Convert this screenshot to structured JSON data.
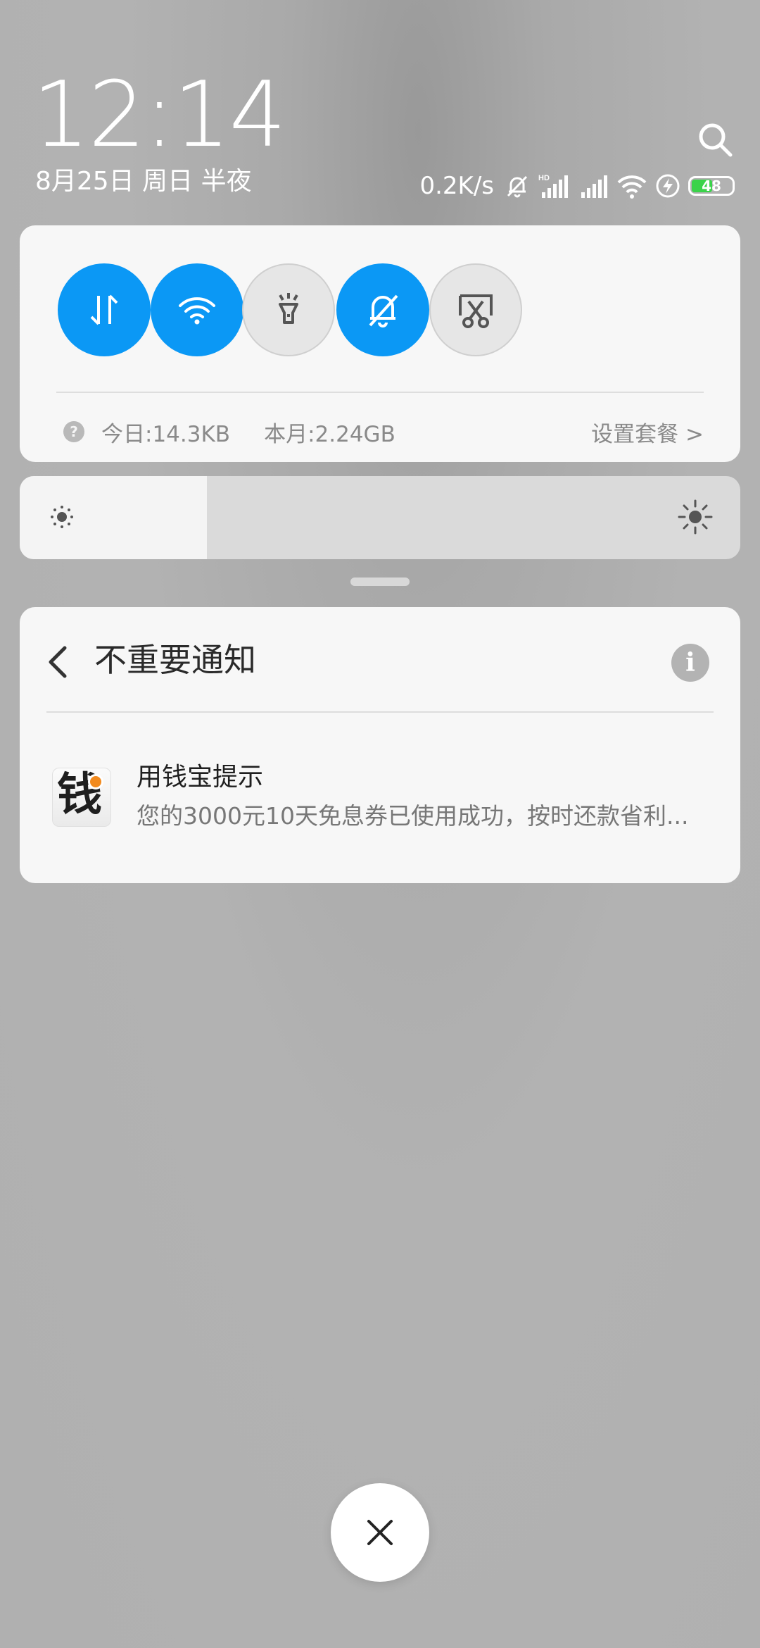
{
  "header": {
    "time": "12:14",
    "date": "8月25日 周日 半夜",
    "net_speed": "0.2K/s",
    "battery_level": "48"
  },
  "status_icons": [
    "mute-bell-icon",
    "hd-signal-icon",
    "signal-icon",
    "wifi-icon",
    "charging-icon",
    "battery-icon"
  ],
  "quick_settings": {
    "toggles": [
      {
        "name": "mobile-data",
        "icon": "data-arrows-icon",
        "state": "on"
      },
      {
        "name": "wifi",
        "icon": "wifi-icon",
        "state": "on"
      },
      {
        "name": "flashlight",
        "icon": "flashlight-icon",
        "state": "off"
      },
      {
        "name": "silent",
        "icon": "mute-bell-icon",
        "state": "on"
      },
      {
        "name": "screenshot",
        "icon": "scissors-icon",
        "state": "off"
      }
    ],
    "today_usage": "今日:14.3KB",
    "month_usage": "本月:2.24GB",
    "plan_link": "设置套餐 >",
    "help_glyph": "?"
  },
  "brightness": {
    "level": 0.26
  },
  "notification_group": {
    "title": "不重要通知",
    "info_glyph": "i",
    "items": [
      {
        "app_name": "用钱宝提示",
        "icon_glyph": "钱",
        "text": "您的3000元10天免息券已使用成功，按时还款省利..."
      }
    ]
  },
  "colors": {
    "toggle_on": "#0b98f5",
    "toggle_off": "#e6e6e6",
    "card_bg": "#f7f7f7",
    "icon_accent": "#f28a1e"
  }
}
